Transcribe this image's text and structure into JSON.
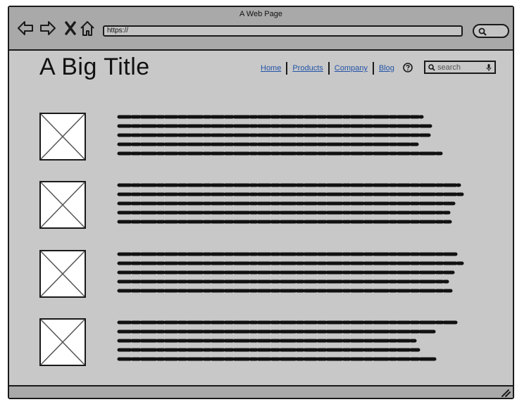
{
  "window": {
    "title": "A Web Page",
    "address": "https://"
  },
  "page": {
    "title": "A Big Title",
    "nav": [
      {
        "label": "Home"
      },
      {
        "label": "Products"
      },
      {
        "label": "Company"
      },
      {
        "label": "Blog"
      }
    ],
    "search_placeholder": "search",
    "items": [
      {
        "image": "image-placeholder",
        "text_lines": 5
      },
      {
        "image": "image-placeholder",
        "text_lines": 5
      },
      {
        "image": "image-placeholder",
        "text_lines": 5
      },
      {
        "image": "image-placeholder",
        "text_lines": 5
      }
    ]
  },
  "icons": {
    "back": "back-arrow-icon",
    "forward": "forward-arrow-icon",
    "stop": "close-icon",
    "home": "home-icon",
    "help": "help-icon",
    "search": "search-icon",
    "mic": "microphone-icon",
    "resize": "resize-grip-icon"
  },
  "colors": {
    "page_bg": "#c8c8c8",
    "chrome_bg": "#a9a9a9",
    "link": "#2353a7",
    "ink": "#1a1a1a"
  }
}
